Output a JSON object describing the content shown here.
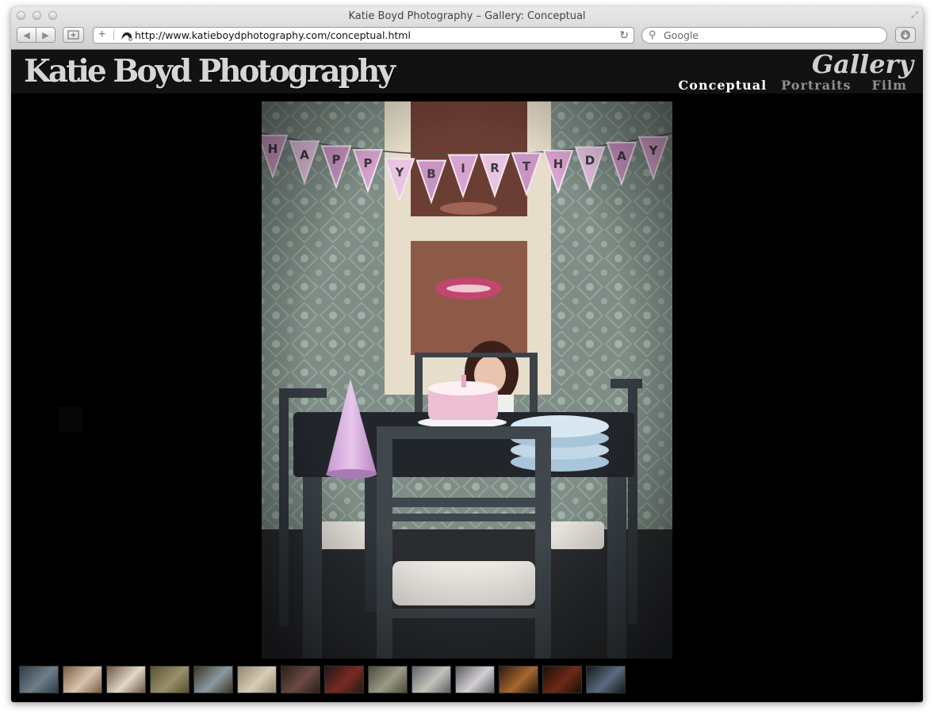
{
  "browser": {
    "window_title": "Katie Boyd Photography – Gallery: Conceptual",
    "url": "http://www.katieboydphotography.com/conceptual.html",
    "search_placeholder": "Google"
  },
  "site": {
    "logo_text": "Katie Boyd Photography",
    "section_title": "Gallery",
    "nav": {
      "conceptual": "Conceptual",
      "portraits": "Portraits",
      "film": "Film"
    },
    "active_nav": "Conceptual"
  },
  "photo": {
    "banner_letters": [
      "H",
      "A",
      "P",
      "P",
      "Y",
      "B",
      "I",
      "R",
      "T",
      "H",
      "D",
      "A",
      "Y"
    ]
  },
  "thumbnails": {
    "count": 14
  },
  "colors": {
    "page_background": "#000000",
    "header_background": "#121212",
    "nav_active": "#ffffff",
    "nav_inactive": "#8f8f8f",
    "banner_pink": "#d9a3cf"
  }
}
